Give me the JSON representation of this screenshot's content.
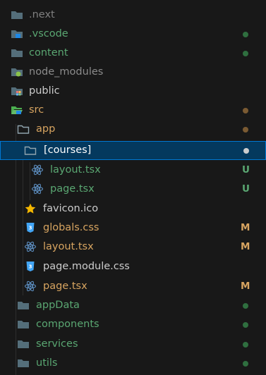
{
  "explorer": {
    "rows": [
      {
        "label": ".next",
        "icon": "folder-icon",
        "color": "#7f7f7f",
        "status": null
      },
      {
        "label": ".vscode",
        "icon": "folder-vscode-icon",
        "color": "#5aa772",
        "status": "dot"
      },
      {
        "label": "content",
        "icon": "folder-icon",
        "color": "#5aa772",
        "status": "dot"
      },
      {
        "label": "node_modules",
        "icon": "folder-node-icon",
        "color": "#8b8b8b",
        "status": null
      },
      {
        "label": "public",
        "icon": "folder-public-icon",
        "color": "#cccccc",
        "status": null
      },
      {
        "label": "src",
        "icon": "folder-src-open-icon",
        "color": "#d7a460",
        "status": "dot"
      },
      {
        "label": "app",
        "icon": "folder-open-icon",
        "color": "#d7a460",
        "status": "dot"
      },
      {
        "label": "[courses]",
        "icon": "folder-open-icon",
        "color": "#ffffff",
        "status": "dot"
      },
      {
        "label": "layout.tsx",
        "icon": "react-icon",
        "color": "#5aa772",
        "status": "U"
      },
      {
        "label": "page.tsx",
        "icon": "react-icon",
        "color": "#5aa772",
        "status": "U"
      },
      {
        "label": "favicon.ico",
        "icon": "star-icon",
        "color": "#cccccc",
        "status": null
      },
      {
        "label": "globals.css",
        "icon": "css-icon",
        "color": "#d7a460",
        "status": "M"
      },
      {
        "label": "layout.tsx",
        "icon": "react-icon",
        "color": "#d7a460",
        "status": "M"
      },
      {
        "label": "page.module.css",
        "icon": "css-icon",
        "color": "#cccccc",
        "status": null
      },
      {
        "label": "page.tsx",
        "icon": "react-icon",
        "color": "#d7a460",
        "status": "M"
      },
      {
        "label": "appData",
        "icon": "folder-icon",
        "color": "#5aa772",
        "status": "dot"
      },
      {
        "label": "components",
        "icon": "folder-icon",
        "color": "#5aa772",
        "status": "dot"
      },
      {
        "label": "services",
        "icon": "folder-icon",
        "color": "#5aa772",
        "status": "dot"
      },
      {
        "label": "utils",
        "icon": "folder-icon",
        "color": "#5aa772",
        "status": "dot"
      }
    ]
  },
  "colors": {
    "background": "#181818",
    "selected_bg": "#04395e",
    "selected_border": "#0078d4",
    "untracked": "#5aa772",
    "modified": "#d7a460",
    "ignored": "#8b8b8b",
    "dot_green": "#2f6f3f",
    "dot_brown": "#7a5a32",
    "dot_white": "#cccccc"
  }
}
